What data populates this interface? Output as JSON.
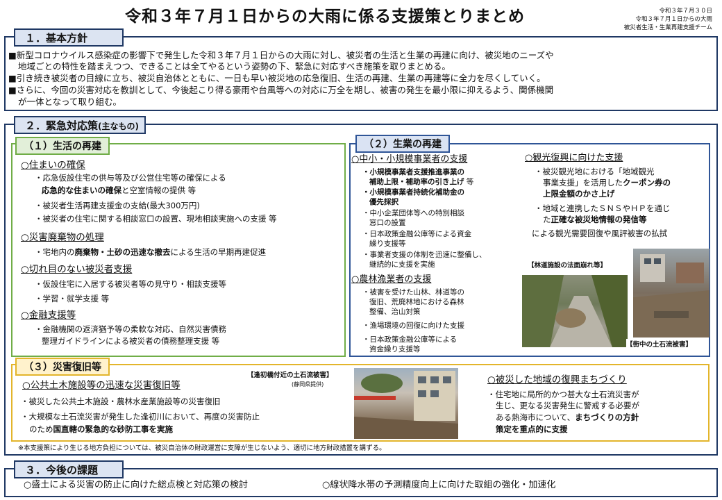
{
  "header": {
    "title": "令和３年７月１日からの大雨に係る支援策とりまとめ",
    "meta": [
      "令和３年７月３０日",
      "令和３年７月１日からの大雨",
      "被災者生活・生業再建支援チーム"
    ]
  },
  "s1": {
    "heading": "１．基本方針",
    "p1a": "■新型コロナウイルス感染症の影響下で発生した令和３年７月１日からの大雨に対し、被災者の生活と生業の再建に向け、被災地のニーズや",
    "p1b": "地域ごとの特性を踏まえつつ、できることは全てやるという姿勢の下、緊急に対応すべき施策を取りまとめる。",
    "p2": "■引き続き被災者の目線に立ち、被災自治体とともに、一日も早い被災地の応急復旧、生活の再建、生業の再建等に全力を尽くしていく。",
    "p3a": "■さらに、今回の災害対応を教訓として、今後起こり得る豪雨や台風等への対応に万全を期し、被害の発生を最小限に抑えるよう、関係機関",
    "p3b": "が一体となって取り組む。"
  },
  "s2": {
    "heading": "２．緊急対応策",
    "heading_small": "(主なもの)",
    "life": {
      "heading": "（１）生活の再建",
      "housing": "○住まいの確保",
      "housing_1a": "・応急仮設住宅の供与等及び公営住宅等の確保による",
      "housing_1b_bold": "応急的な住まいの確保",
      "housing_1b_rest": "と空室情報の提供 等",
      "housing_2": "・被災者生活再建支援金の支給(最大300万円)",
      "housing_3": "・被災者の住宅に関する相談窓口の設置、現地相談実施への支援 等",
      "waste": "○災害廃棄物の処理",
      "waste_1_pre": "・宅地内の",
      "waste_1_bold": "廃棄物・土砂の迅速な撤去",
      "waste_1_post": "による生活の早期再建促進",
      "seamless": "○切れ目のない被災者支援",
      "seamless_1": "・仮設住宅に入居する被災者等の見守り・相談支援等",
      "seamless_2": "・学習・就学支援 等",
      "finance": "○金融支援等",
      "finance_1a": "・金融機関の返済猶予等の柔軟な対応、自然災害債務",
      "finance_1b": "整理ガイドラインによる被災者の債務整理支援 等"
    },
    "biz": {
      "heading": "（２）生業の再建",
      "sme": "○中小・小規模事業者の支援",
      "sme_1a": "・小規模事業者支援推進事業の",
      "sme_1b_bold": "補助上限・補助率の引き上げ",
      "sme_1b_rest": " 等",
      "sme_2a": "・小規模事業者持続化補助金の",
      "sme_2b": "優先採択",
      "sme_3a": "・中小企業団体等への特別相談",
      "sme_3b": "窓口の設置",
      "sme_4a": "・日本政策金融公庫等による資金",
      "sme_4b": "繰り支援等",
      "sme_5a": "・事業者支援の体制を迅速に整備し、",
      "sme_5b": "継続的に支援を実施",
      "agri": "○農林漁業者の支援",
      "agri_1a": "・被害を受けた山林、林道等の",
      "agri_1b": "復旧、荒廃林地における森林",
      "agri_1c": "整備、治山対策",
      "agri_2": "・漁場環境の回復に向けた支援",
      "agri_3a": "・日本政策金融公庫等による",
      "agri_3b": "資金繰り支援等",
      "tour": "○観光復興に向けた支援",
      "tour_1a": "・被災観光地における「地域観光",
      "tour_1b_pre": "事業支援」を活用した",
      "tour_1b_bold": "クーポン券の",
      "tour_1c_bold": "上限金額のかさ上げ",
      "tour_2a": "・地域と連携したＳＮＳやＨＰを通じ",
      "tour_2b_pre": "た",
      "tour_2b_bold": "正確な被災地情報の発信等",
      "tour_3": "による観光需要回復や風評被害の払拭",
      "photo1_caption": "【林道施設の法面崩れ等】",
      "photo2_caption": "【街中の土石流被害】"
    },
    "recovery": {
      "heading": "（３）災害復旧等",
      "photo_caption": "【逢初橋付近の土石流被害】",
      "photo_credit": "(静岡県提供)",
      "public": "○公共土木施設等の迅速な災害復旧等",
      "public_1": "・被災した公共土木施設・農林水産業施設等の災害復旧",
      "public_2a": "・大規模な土石流災害が発生した逢初川において、再度の災害防止",
      "public_2b_pre": "のため",
      "public_2b_bold": "国直轄の緊急的な砂防工事を実施",
      "town": "○被災した地域の復興まちづくり",
      "town_1a": "・住宅地に局所的かつ甚大な土石流災害が",
      "town_1b": "生じ、更なる災害発生に警戒する必要が",
      "town_1c_pre": "ある熱海市について、",
      "town_1c_bold": "まちづくりの方針",
      "town_1d_bold": "策定を重点的に支援"
    },
    "footnote": "※本支援策により生じる地方負担については、被災自治体の財政運営に支障が生じないよう、適切に地方財政措置を講ずる。"
  },
  "s3": {
    "heading": "３．今後の課題",
    "item1": "○盛土による災害の防止に向けた総点検と対応策の検討",
    "item2": "○線状降水帯の予測精度向上に向けた取組の強化・加速化"
  },
  "colors": {
    "navy": "#1f3864",
    "green": "#70ad47",
    "blue": "#2f5597",
    "yellow": "#e3b52b"
  }
}
